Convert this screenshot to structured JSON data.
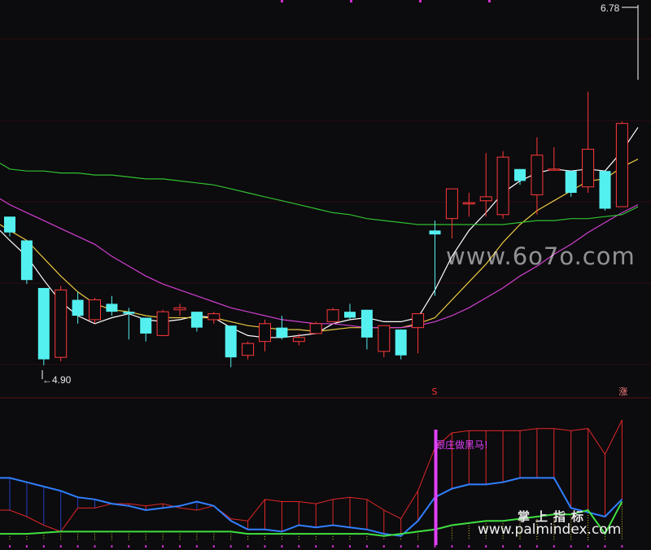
{
  "chart_data": [
    {
      "type": "candlestick",
      "title": "",
      "price_max_label": "6.78",
      "price_min_label": "4.90",
      "candles": [
        {
          "o": 5.72,
          "h": 5.72,
          "l": 5.62,
          "c": 5.64
        },
        {
          "o": 5.6,
          "h": 5.6,
          "l": 5.38,
          "c": 5.4
        },
        {
          "o": 5.36,
          "h": 5.36,
          "l": 4.97,
          "c": 5.0
        },
        {
          "o": 5.01,
          "h": 5.37,
          "l": 4.99,
          "c": 5.35
        },
        {
          "o": 5.3,
          "h": 5.34,
          "l": 5.18,
          "c": 5.22
        },
        {
          "o": 5.2,
          "h": 5.31,
          "l": 5.18,
          "c": 5.3
        },
        {
          "o": 5.28,
          "h": 5.32,
          "l": 5.22,
          "c": 5.24
        },
        {
          "o": 5.24,
          "h": 5.26,
          "l": 5.1,
          "c": 5.23
        },
        {
          "o": 5.21,
          "h": 5.21,
          "l": 5.09,
          "c": 5.13
        },
        {
          "o": 5.12,
          "h": 5.25,
          "l": 5.12,
          "c": 5.24
        },
        {
          "o": 5.25,
          "h": 5.28,
          "l": 5.22,
          "c": 5.26
        },
        {
          "o": 5.24,
          "h": 5.24,
          "l": 5.14,
          "c": 5.16
        },
        {
          "o": 5.2,
          "h": 5.24,
          "l": 5.18,
          "c": 5.23
        },
        {
          "o": 5.17,
          "h": 5.17,
          "l": 4.96,
          "c": 5.01
        },
        {
          "o": 5.02,
          "h": 5.09,
          "l": 5.0,
          "c": 5.08
        },
        {
          "o": 5.09,
          "h": 5.2,
          "l": 5.04,
          "c": 5.18
        },
        {
          "o": 5.16,
          "h": 5.22,
          "l": 5.1,
          "c": 5.11
        },
        {
          "o": 5.09,
          "h": 5.13,
          "l": 5.07,
          "c": 5.11
        },
        {
          "o": 5.13,
          "h": 5.19,
          "l": 5.13,
          "c": 5.18
        },
        {
          "o": 5.19,
          "h": 5.26,
          "l": 5.19,
          "c": 5.25
        },
        {
          "o": 5.24,
          "h": 5.28,
          "l": 5.2,
          "c": 5.21
        },
        {
          "o": 5.25,
          "h": 5.25,
          "l": 5.05,
          "c": 5.11
        },
        {
          "o": 5.04,
          "h": 5.17,
          "l": 5.01,
          "c": 5.17
        },
        {
          "o": 5.15,
          "h": 5.15,
          "l": 5.0,
          "c": 5.02
        },
        {
          "o": 5.16,
          "h": 5.22,
          "l": 5.03,
          "c": 5.23
        },
        {
          "o": 5.65,
          "h": 5.7,
          "l": 5.32,
          "c": 5.63
        },
        {
          "o": 5.71,
          "h": 5.86,
          "l": 5.61,
          "c": 5.86
        },
        {
          "o": 5.79,
          "h": 5.84,
          "l": 5.72,
          "c": 5.79
        },
        {
          "o": 5.8,
          "h": 6.04,
          "l": 5.72,
          "c": 5.82
        },
        {
          "o": 5.73,
          "h": 6.05,
          "l": 5.71,
          "c": 6.02
        },
        {
          "o": 5.96,
          "h": 5.96,
          "l": 5.88,
          "c": 5.9
        },
        {
          "o": 5.83,
          "h": 6.12,
          "l": 5.73,
          "c": 6.03
        },
        {
          "o": 5.96,
          "h": 6.07,
          "l": 5.96,
          "c": 5.96
        },
        {
          "o": 5.95,
          "h": 5.95,
          "l": 5.82,
          "c": 5.84
        },
        {
          "o": 5.87,
          "h": 6.35,
          "l": 5.84,
          "c": 6.06
        },
        {
          "o": 5.95,
          "h": 5.95,
          "l": 5.75,
          "c": 5.76
        },
        {
          "o": 5.77,
          "h": 6.2,
          "l": 5.77,
          "c": 6.19
        }
      ],
      "moving_averages": [
        {
          "color": "#ffffff",
          "values": [
            5.6,
            5.52,
            5.4,
            5.29,
            5.22,
            5.18,
            5.21,
            5.23,
            5.2,
            5.19,
            5.2,
            5.22,
            5.21,
            5.16,
            5.12,
            5.11,
            5.11,
            5.12,
            5.13,
            5.18,
            5.2,
            5.21,
            5.19,
            5.19,
            5.21,
            5.35,
            5.52,
            5.65,
            5.74,
            5.84,
            5.9,
            5.94,
            5.96,
            5.95,
            5.96,
            5.95,
            6.05
          ]
        },
        {
          "color": "#e8c840",
          "values": [
            5.65,
            5.6,
            5.51,
            5.42,
            5.34,
            5.28,
            5.25,
            5.24,
            5.22,
            5.21,
            5.21,
            5.21,
            5.21,
            5.19,
            5.17,
            5.16,
            5.15,
            5.15,
            5.14,
            5.15,
            5.16,
            5.16,
            5.16,
            5.16,
            5.18,
            5.21,
            5.3,
            5.39,
            5.48,
            5.59,
            5.68,
            5.75,
            5.8,
            5.85,
            5.9,
            5.91,
            5.97
          ]
        },
        {
          "color": "#d040d0",
          "values": [
            5.78,
            5.74,
            5.7,
            5.66,
            5.62,
            5.58,
            5.52,
            5.47,
            5.42,
            5.38,
            5.35,
            5.32,
            5.29,
            5.26,
            5.24,
            5.22,
            5.2,
            5.19,
            5.18,
            5.18,
            5.17,
            5.16,
            5.16,
            5.16,
            5.17,
            5.19,
            5.22,
            5.26,
            5.31,
            5.36,
            5.42,
            5.47,
            5.53,
            5.58,
            5.64,
            5.69,
            5.74
          ]
        },
        {
          "color": "#30c030",
          "values": [
            5.96,
            5.95,
            5.95,
            5.94,
            5.94,
            5.93,
            5.93,
            5.92,
            5.91,
            5.91,
            5.9,
            5.89,
            5.88,
            5.86,
            5.84,
            5.82,
            5.8,
            5.78,
            5.76,
            5.74,
            5.73,
            5.71,
            5.7,
            5.69,
            5.68,
            5.68,
            5.68,
            5.68,
            5.68,
            5.68,
            5.69,
            5.7,
            5.7,
            5.71,
            5.71,
            5.72,
            5.73
          ]
        }
      ],
      "markers": [
        {
          "index": 25,
          "glyph": "S",
          "color": "#ff3333"
        },
        {
          "index": 36,
          "glyph": "涨",
          "color": "#ff8080"
        }
      ]
    },
    {
      "type": "line",
      "title": "",
      "signal_label": "跟庄做黑马!",
      "signal_index": 25,
      "series": [
        {
          "color": "#e02828",
          "values": [
            28,
            22,
            14,
            8,
            30,
            30,
            34,
            34,
            32,
            34,
            30,
            28,
            32,
            20,
            18,
            38,
            36,
            36,
            34,
            38,
            40,
            38,
            28,
            20,
            46,
            86,
            100,
            102,
            102,
            102,
            102,
            104,
            104,
            102,
            104,
            80,
            112
          ]
        },
        {
          "color": "#3080ff",
          "values": [
            58,
            54,
            50,
            46,
            40,
            38,
            34,
            32,
            28,
            30,
            32,
            36,
            32,
            18,
            10,
            10,
            8,
            14,
            12,
            14,
            12,
            10,
            6,
            4,
            18,
            40,
            48,
            52,
            52,
            54,
            58,
            58,
            58,
            30,
            26,
            22,
            38
          ]
        },
        {
          "color": "#40e040",
          "values": [
            6,
            6,
            7,
            8,
            8,
            8,
            8,
            8,
            8,
            8,
            8,
            8,
            8,
            8,
            6,
            6,
            6,
            6,
            6,
            6,
            6,
            6,
            4,
            6,
            8,
            10,
            14,
            16,
            18,
            18,
            20,
            22,
            24,
            24,
            28,
            6,
            36
          ]
        }
      ]
    }
  ],
  "watermarks": {
    "domain": "www.6o7o.com",
    "cn": "掌上指标",
    "site": "www.palmindex.com"
  }
}
